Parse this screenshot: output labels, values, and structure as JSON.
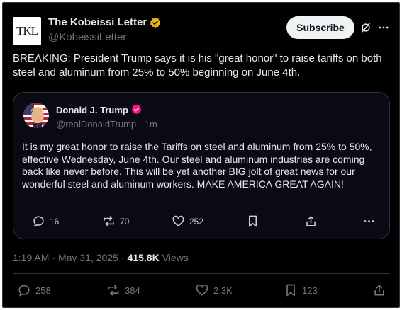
{
  "author": {
    "avatar_text": "TKL",
    "name": "The Kobeissi Letter",
    "handle": "@KobeissiLetter",
    "badge_color": "#e2b719"
  },
  "subscribe_label": "Subscribe",
  "tweet_text": "BREAKING: President Trump says it is his \"great honor\" to raise tariffs on both steel and aluminum from 25% to 50% beginning on June 4th.",
  "quoted": {
    "name": "Donald J. Trump",
    "handle": "@realDonaldTrump",
    "separator": "·",
    "time": "1m",
    "text": "It is my great honor to raise the Tariffs on steel and aluminum from 25% to 50%, effective Wednesday, June 4th. Our steel and aluminum industries are coming back like never before. This will be yet another BIG jolt of great news for our wonderful steel and aluminum workers. MAKE AMERICA GREAT AGAIN!",
    "badge_color": "#f91880",
    "replies": "16",
    "reposts": "70",
    "likes": "252"
  },
  "meta": {
    "time": "1:19 AM",
    "dot": "·",
    "date": "May 31, 2025",
    "dot2": "·",
    "views_count": "415.8K",
    "views_label": "Views"
  },
  "actions": {
    "replies": "258",
    "reposts": "384",
    "likes": "2.3K",
    "bookmarks": "123"
  },
  "colors": {
    "background": "#000000",
    "text": "#e7e9ea",
    "secondary": "#71767b",
    "border": "#2f3336"
  }
}
